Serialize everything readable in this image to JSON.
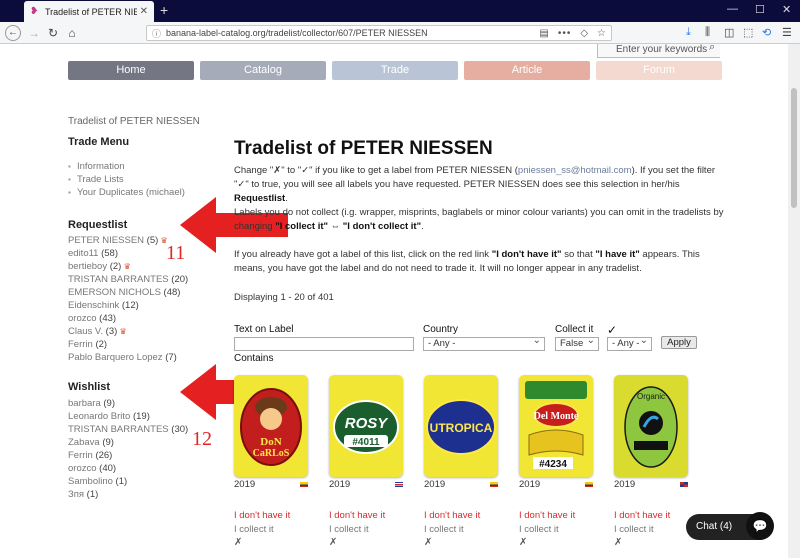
{
  "browser": {
    "tab_title": "Tradelist of PETER NIESSEN | Ba",
    "url": "banana-label-catalog.org/tradelist/collector/607/PETER NIESSEN"
  },
  "search": {
    "placeholder": "Enter your keywords"
  },
  "menu": [
    {
      "label": "Home",
      "color": "#747683"
    },
    {
      "label": "Catalog",
      "color": "#a6abb9"
    },
    {
      "label": "Trade",
      "color": "#b9c5d6"
    },
    {
      "label": "Article",
      "color": "#e6aea0"
    },
    {
      "label": "Forum",
      "color": "#f3d9d0"
    }
  ],
  "breadcrumb": "Tradelist of PETER NIESSEN",
  "sidebar": {
    "trade_menu_title": "Trade Menu",
    "trade_menu": [
      "Information",
      "Trade Lists",
      "Your Duplicates (michael)"
    ],
    "requestlist_title": "Requestlist",
    "requestlist": [
      {
        "name": "PETER NIESSEN",
        "count": "(5)",
        "badge": true
      },
      {
        "name": "edito11",
        "count": "(58)",
        "badge": false
      },
      {
        "name": "bertieboy",
        "count": "(2)",
        "badge": true
      },
      {
        "name": "TRISTAN BARRANTES",
        "count": "(20)",
        "badge": false
      },
      {
        "name": "EMERSON NICHOLS",
        "count": "(48)",
        "badge": false
      },
      {
        "name": "Eidenschink",
        "count": "(12)",
        "badge": false
      },
      {
        "name": "orozco",
        "count": "(43)",
        "badge": false
      },
      {
        "name": "Claus V.",
        "count": "(3)",
        "badge": true
      },
      {
        "name": "Ferrin",
        "count": "(2)",
        "badge": false
      },
      {
        "name": "Pablo Barquero Lopez",
        "count": "(7)",
        "badge": false
      }
    ],
    "wishlist_title": "Wishlist",
    "wishlist": [
      {
        "name": "barbara",
        "count": "(9)"
      },
      {
        "name": "Leonardo Brito",
        "count": "(19)"
      },
      {
        "name": "TRISTAN BARRANTES",
        "count": "(30)"
      },
      {
        "name": "Zabava",
        "count": "(9)"
      },
      {
        "name": "Ferrin",
        "count": "(26)"
      },
      {
        "name": "orozco",
        "count": "(40)"
      },
      {
        "name": "Sambolino",
        "count": "(1)"
      },
      {
        "name": "Зпя",
        "count": "(1)"
      }
    ]
  },
  "annotations": {
    "first": "11",
    "second": "12",
    "color": "#e52020"
  },
  "main": {
    "title": "Tradelist of PETER NIESSEN",
    "p1_a": "Change \"✗\" to \"✓\" if you like to get a label from PETER NIESSEN (",
    "p1_email": "pniessen_ss@hotmail.com",
    "p1_b": "). If you set the filter \"✓\" to true, you will see all labels you have requested. PETER NIESSEN does see this selection in her/his ",
    "p1_bold": "Requestlist",
    "p1_c": ".",
    "p2_a": "Labels you do not collect (i.g. wrapper, misprints, baglabels or minor colour variants) you can omit in the tradelists by changing ",
    "p2_b": "\"I collect it\" ⇔ \"I don't collect it\"",
    "p2_c": ".",
    "p3_a": "If you already have got a label of this list, click on the red link ",
    "p3_b": "\"I don't have it\"",
    "p3_c": " so that ",
    "p3_d": "\"I have it\"",
    "p3_e": " appears. This means, you have got the label and do not need to trade it. It will no longer appear in any tradelist.",
    "displaying": "Displaying 1 - 20 of 401"
  },
  "filter": {
    "text_label": "Text on Label",
    "text_value": "",
    "contains": "Contains",
    "country_label": "Country",
    "country_value": "- Any -",
    "collect_label": "Collect it",
    "collect_value": "False",
    "check_label": "✓",
    "check_value": "- Any -",
    "apply": "Apply"
  },
  "labels": [
    {
      "brand": "DoN CaRLoS",
      "sub": "ECUADOR",
      "year": "2019",
      "flag": "ecuador",
      "dont": "I don't have it",
      "collect": "I collect it",
      "mark": "✗"
    },
    {
      "brand": "ROSY",
      "sub": "#4011",
      "top": "BANANO DE COSTA RICA",
      "year": "2019",
      "flag": "costarica",
      "dont": "I don't have it",
      "collect": "I collect it",
      "mark": "✗"
    },
    {
      "brand": "UTROPICA",
      "sub": "Product of Ecuador",
      "top": "Premium Bananas",
      "year": "2019",
      "flag": "ecuador",
      "dont": "I don't have it",
      "collect": "I collect it",
      "mark": "✗"
    },
    {
      "brand": "Del Monte",
      "sub": "#4234",
      "top": "ECUADOR BABY",
      "year": "2019",
      "flag": "ecuador",
      "dont": "I don't have it",
      "collect": "I collect it",
      "mark": "✗"
    },
    {
      "brand": "Organic",
      "sub": "FAIRTRADE",
      "year": "2019",
      "flag": "dominican",
      "dont": "I don't have it",
      "collect": "I collect it",
      "mark": "✗"
    }
  ],
  "chat": {
    "label": "Chat (4)"
  }
}
